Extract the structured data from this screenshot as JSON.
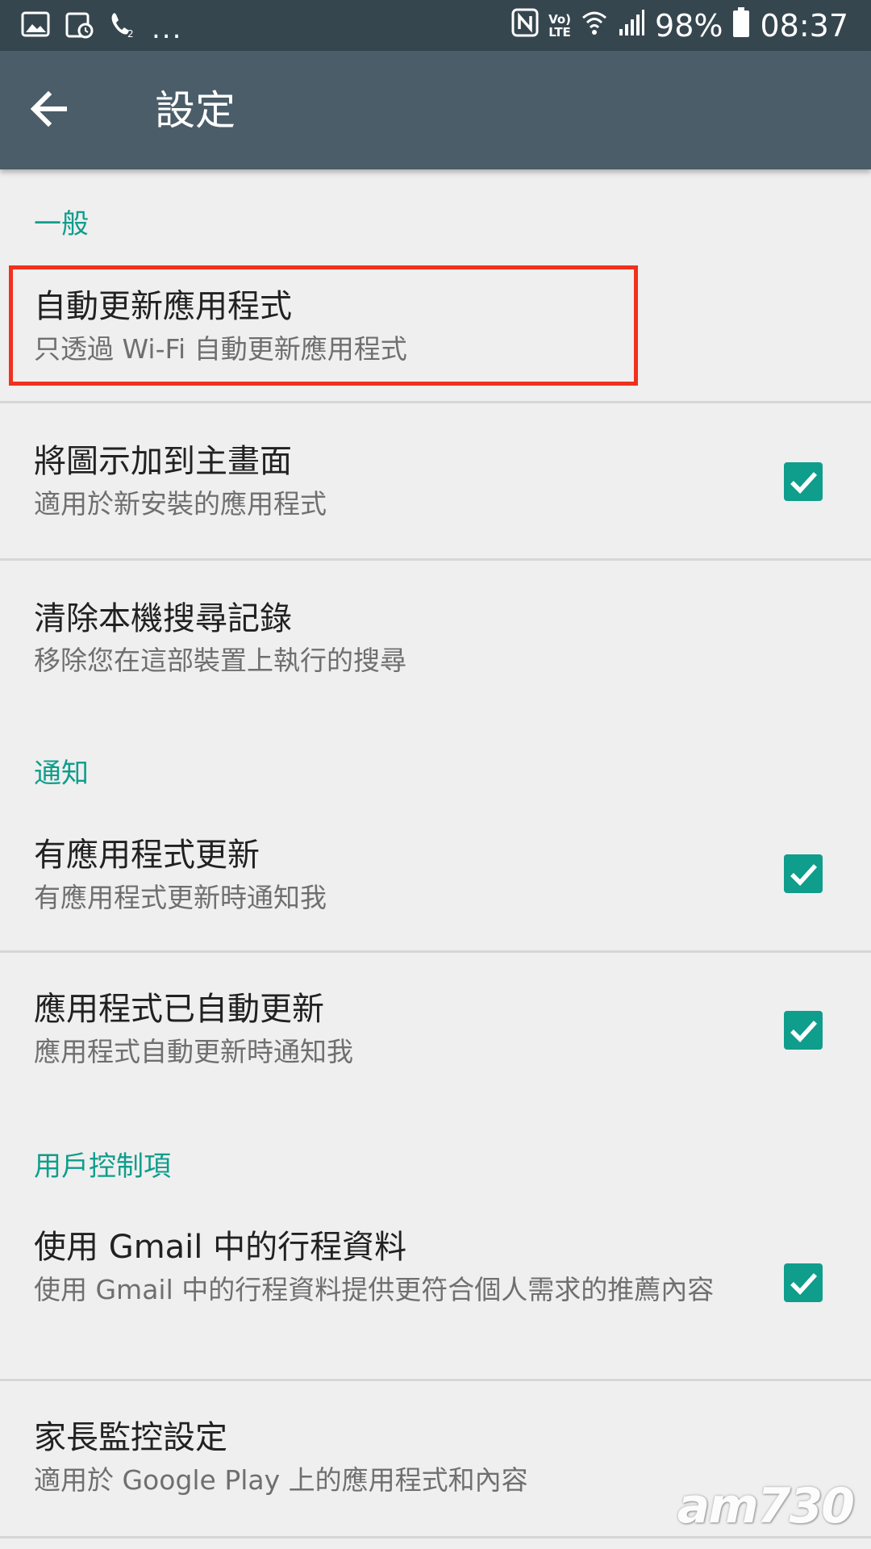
{
  "status_bar": {
    "battery_percent": "98%",
    "time": "08:37",
    "dots": "...",
    "lte_top": "Vo)",
    "lte_bottom": "LTE"
  },
  "app_bar": {
    "title": "設定"
  },
  "sections": {
    "general": "一般",
    "notifications": "通知",
    "user_controls": "用戶控制項"
  },
  "items": {
    "auto_update": {
      "title": "自動更新應用程式",
      "subtitle": "只透過 Wi-Fi 自動更新應用程式"
    },
    "add_icon": {
      "title": "將圖示加到主畫面",
      "subtitle": "適用於新安裝的應用程式",
      "checked": true
    },
    "clear_history": {
      "title": "清除本機搜尋記錄",
      "subtitle": "移除您在這部裝置上執行的搜尋"
    },
    "app_updates": {
      "title": "有應用程式更新",
      "subtitle": "有應用程式更新時通知我",
      "checked": true
    },
    "auto_updated": {
      "title": "應用程式已自動更新",
      "subtitle": "應用程式自動更新時通知我",
      "checked": true
    },
    "gmail_trips": {
      "title": "使用 Gmail 中的行程資料",
      "subtitle": "使用 Gmail 中的行程資料提供更符合個人需求的推薦內容",
      "checked": true
    },
    "parental_controls": {
      "title": "家長監控設定",
      "subtitle": "適用於 Google Play 上的應用程式和內容"
    }
  },
  "watermark": "am730",
  "colors": {
    "status_bar": "#36464f",
    "app_bar": "#4a5d68",
    "accent": "#0f9d8c",
    "highlight": "#f2301d",
    "background": "#efefef"
  }
}
